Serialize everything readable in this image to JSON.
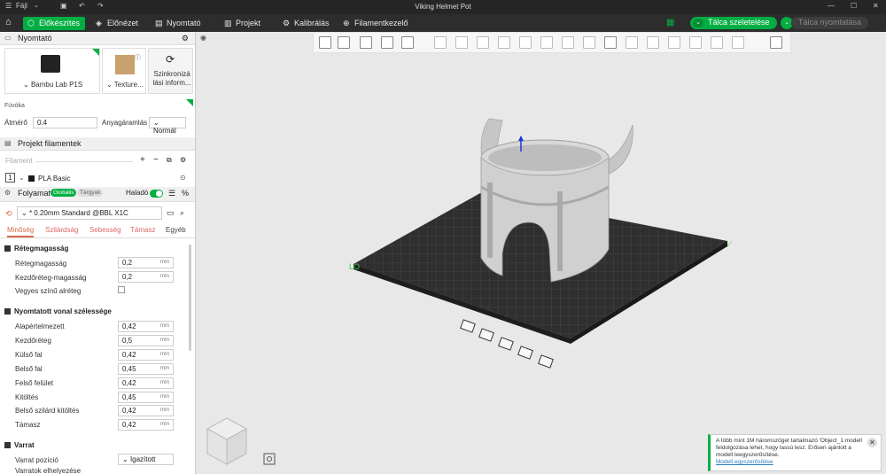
{
  "titlebar": {
    "title": "Viking Helmet Pot",
    "file_menu": "Fájl"
  },
  "tabs": [
    {
      "label": "Előkészítés",
      "icon": "cube-icon"
    },
    {
      "label": "Előnézet",
      "icon": "layers-icon"
    },
    {
      "label": "Nyomtató",
      "icon": "printer-icon"
    },
    {
      "label": "Projekt",
      "icon": "document-icon"
    },
    {
      "label": "Kalibrálás",
      "icon": "gear-icon"
    },
    {
      "label": "Filamentkezelő",
      "icon": "filament-icon"
    }
  ],
  "actions": {
    "slice": "Tálca szeletelése",
    "print": "Tálca nyomtatása"
  },
  "printer": {
    "header": "Nyomtató",
    "name": "Bambu Lab P1S",
    "plate": "Texture...",
    "sync": "Szinkronizá lási inform...",
    "nozzle_label": "Fúvóka",
    "diameter_label": "Átmérő",
    "diameter_value": "0.4",
    "flow_label": "Anyagáramlás",
    "flow_value": "Normál"
  },
  "filaments": {
    "header": "Projekt filamentek",
    "placeholder": "Filament",
    "items": [
      {
        "index": "1",
        "name": "PLA Basic",
        "color": "#1a1a1a"
      }
    ]
  },
  "process": {
    "header": "Folyamat",
    "toggle_global": "Globális",
    "toggle_objects": "Tárgyak",
    "advanced": "Haladó",
    "preset": "* 0.20mm Standard @BBL X1C",
    "tabs": [
      "Minőség",
      "Szilárdság",
      "Sebesség",
      "Támasz",
      "Egyéb"
    ],
    "groups": {
      "layer": "Rétegmagasság",
      "width": "Nyomtatott vonal szélessége",
      "seam": "Varrat"
    },
    "layer_height": {
      "label": "Rétegmagasság",
      "value": "0,2",
      "unit": "mm"
    },
    "first_layer_height": {
      "label": "Kezdőréteg-magasság",
      "value": "0,2",
      "unit": "mm"
    },
    "mixed_color": {
      "label": "Vegyes színű alréteg"
    },
    "widths": [
      {
        "label": "Alapértelmezett",
        "value": "0,42",
        "unit": "mm"
      },
      {
        "label": "Kezdőréteg",
        "value": "0,5",
        "unit": "mm"
      },
      {
        "label": "Külső fal",
        "value": "0,42",
        "unit": "mm"
      },
      {
        "label": "Belső fal",
        "value": "0,45",
        "unit": "mm"
      },
      {
        "label": "Felső felület",
        "value": "0,42",
        "unit": "mm"
      },
      {
        "label": "Kitöltés",
        "value": "0,45",
        "unit": "mm"
      },
      {
        "label": "Belső szilárd kitöltés",
        "value": "0,42",
        "unit": "mm"
      },
      {
        "label": "Támasz",
        "value": "0,42",
        "unit": "mm"
      }
    ],
    "seam_position": {
      "label": "Varrat pozíció",
      "value": "Igazított"
    },
    "seam_placement": {
      "label": "Varratok elhelyezése"
    }
  },
  "notification": {
    "text": "A több mint 1M háromszöget tartalmazó 'Object_1 modell feldolgozása lehet, hogy lassú lesz. Erősen ajánlott a modell leegyszerűsítése.",
    "link": "Modell egyszerűsítése"
  },
  "colors": {
    "accent": "#00ae42",
    "titlebar": "#262626",
    "tabbar": "#2d2d2d",
    "active_tab_text": "#d66a4a"
  }
}
